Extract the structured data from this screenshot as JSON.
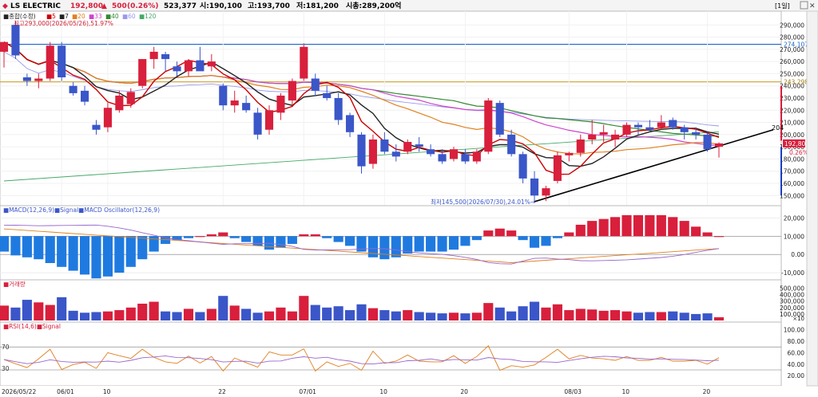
{
  "header": {
    "stock_name": "LS ELECTRIC",
    "price": "192,800",
    "change_arrow": "▲",
    "change": "500",
    "change_pct": "(0.26%)",
    "volume": "523,377",
    "open_label": "시:190,100",
    "high_label": "고:193,700",
    "low_label": "저:181,200",
    "mcap_label": "시총:289,200억",
    "period_button": "[1일]"
  },
  "main_panel": {
    "legend_title": "■종합(수정)",
    "ma_legend": [
      {
        "label": "5",
        "color": "#cc0000"
      },
      {
        "label": "7",
        "color": "#222222"
      },
      {
        "label": "20",
        "color": "#e08020"
      },
      {
        "label": "33",
        "color": "#cc44cc"
      },
      {
        "label": "40",
        "color": "#338833"
      },
      {
        "label": "60",
        "color": "#9999ee"
      },
      {
        "label": "120",
        "color": "#44aa66"
      }
    ],
    "high_note": "최고293,000(2026/05/26),51.97%",
    "low_note": "최저145,500(2026/07/30),24.01%→",
    "trend_label": "204",
    "price_ticks": [
      "290,000",
      "280,000",
      "270,000",
      "260,000",
      "250,000",
      "240,000",
      "230,000",
      "220,000",
      "210,000",
      "200,000",
      "190,000",
      "180,000",
      "170,000",
      "160,000",
      "150,000"
    ],
    "hline_blue_label": "274,107",
    "hline_gold_label": "243,298",
    "current_price_label": "192,800",
    "current_pct_label": "0.26%",
    "colors": {
      "up": "#d81f3c",
      "down": "#3a56c8",
      "hline_blue": "#1a66cc",
      "hline_gold": "#c9a030"
    }
  },
  "macd_panel": {
    "legend": "■MACD(12,26,9)■Signal■MACD Oscillator(12,26,9)",
    "ticks": [
      "20,000",
      "10,000",
      "0.00",
      "-10,000"
    ]
  },
  "volume_panel": {
    "legend": "■거래량",
    "ticks": [
      "500,000",
      "400,000",
      "300,000",
      "200,000",
      "100,000"
    ],
    "unit": "×10"
  },
  "rsi_panel": {
    "legend": "■RSI(14,6)■Signal",
    "ticks": [
      "100.00",
      "80.00",
      "60.00",
      "40.00",
      "20.00"
    ],
    "level_70": "70",
    "level_30": "30"
  },
  "x_axis": {
    "labels": [
      "2026/05/22",
      "06/01",
      "10",
      "22",
      "07/01",
      "10",
      "20",
      "08/03",
      "10",
      "20"
    ]
  },
  "chart_data": {
    "type": "candlestick",
    "ylim": [
      143000,
      300000
    ],
    "ma_periods": [
      5,
      7,
      20,
      33,
      40,
      60,
      120
    ],
    "dates": [
      "05/22",
      "05/26",
      "05/27",
      "05/28",
      "05/29",
      "06/01",
      "06/02",
      "06/04",
      "06/05",
      "06/08",
      "06/09",
      "06/10",
      "06/11",
      "06/12",
      "06/15",
      "06/16",
      "06/17",
      "06/18",
      "06/19",
      "06/22",
      "06/23",
      "06/24",
      "06/25",
      "06/26",
      "06/29",
      "06/30",
      "07/01",
      "07/02",
      "07/03",
      "07/06",
      "07/07",
      "07/08",
      "07/09",
      "07/10",
      "07/13",
      "07/14",
      "07/15",
      "07/16",
      "07/17",
      "07/20",
      "07/21",
      "07/22",
      "07/23",
      "07/24",
      "07/27",
      "07/28",
      "07/29",
      "07/30",
      "07/31",
      "08/03",
      "08/04",
      "08/05",
      "08/06",
      "08/07",
      "08/10",
      "08/11",
      "08/12",
      "08/13",
      "08/14",
      "08/17",
      "08/18",
      "08/19",
      "08/20"
    ],
    "candles": [
      {
        "o": 268000,
        "h": 275000,
        "l": 255000,
        "c": 276000
      },
      {
        "o": 290000,
        "h": 293000,
        "l": 262000,
        "c": 265000
      },
      {
        "o": 247000,
        "h": 250000,
        "l": 240000,
        "c": 244000
      },
      {
        "o": 244000,
        "h": 250000,
        "l": 238000,
        "c": 246000
      },
      {
        "o": 246000,
        "h": 276000,
        "l": 244000,
        "c": 273000
      },
      {
        "o": 273000,
        "h": 276000,
        "l": 244000,
        "c": 247000
      },
      {
        "o": 240000,
        "h": 243000,
        "l": 232000,
        "c": 234000
      },
      {
        "o": 236000,
        "h": 240000,
        "l": 224000,
        "c": 227000
      },
      {
        "o": 208000,
        "h": 212000,
        "l": 200000,
        "c": 204000
      },
      {
        "o": 206000,
        "h": 226000,
        "l": 202000,
        "c": 222000
      },
      {
        "o": 220000,
        "h": 236000,
        "l": 218000,
        "c": 232000
      },
      {
        "o": 225000,
        "h": 238000,
        "l": 222000,
        "c": 235000
      },
      {
        "o": 240000,
        "h": 262000,
        "l": 238000,
        "c": 262000
      },
      {
        "o": 262000,
        "h": 272000,
        "l": 254000,
        "c": 268000
      },
      {
        "o": 266000,
        "h": 268000,
        "l": 252000,
        "c": 262000
      },
      {
        "o": 256000,
        "h": 260000,
        "l": 248000,
        "c": 252000
      },
      {
        "o": 252000,
        "h": 262000,
        "l": 248000,
        "c": 261000
      },
      {
        "o": 261000,
        "h": 272000,
        "l": 256000,
        "c": 252000
      },
      {
        "o": 256000,
        "h": 266000,
        "l": 252000,
        "c": 260000
      },
      {
        "o": 240000,
        "h": 242000,
        "l": 220000,
        "c": 224000
      },
      {
        "o": 224000,
        "h": 236000,
        "l": 218000,
        "c": 228000
      },
      {
        "o": 226000,
        "h": 232000,
        "l": 218000,
        "c": 220000
      },
      {
        "o": 218000,
        "h": 222000,
        "l": 196000,
        "c": 200000
      },
      {
        "o": 204000,
        "h": 224000,
        "l": 200000,
        "c": 220000
      },
      {
        "o": 218000,
        "h": 234000,
        "l": 212000,
        "c": 232000
      },
      {
        "o": 228000,
        "h": 246000,
        "l": 224000,
        "c": 244000
      },
      {
        "o": 246000,
        "h": 275000,
        "l": 244000,
        "c": 272000
      },
      {
        "o": 246000,
        "h": 250000,
        "l": 232000,
        "c": 236000
      },
      {
        "o": 234000,
        "h": 240000,
        "l": 228000,
        "c": 230000
      },
      {
        "o": 230000,
        "h": 234000,
        "l": 208000,
        "c": 212000
      },
      {
        "o": 216000,
        "h": 218000,
        "l": 198000,
        "c": 202000
      },
      {
        "o": 200000,
        "h": 202000,
        "l": 168000,
        "c": 174000
      },
      {
        "o": 176000,
        "h": 200000,
        "l": 172000,
        "c": 196000
      },
      {
        "o": 196000,
        "h": 202000,
        "l": 184000,
        "c": 186000
      },
      {
        "o": 186000,
        "h": 192000,
        "l": 178000,
        "c": 182000
      },
      {
        "o": 186000,
        "h": 196000,
        "l": 184000,
        "c": 194000
      },
      {
        "o": 192000,
        "h": 198000,
        "l": 186000,
        "c": 190000
      },
      {
        "o": 188000,
        "h": 192000,
        "l": 182000,
        "c": 184000
      },
      {
        "o": 184000,
        "h": 188000,
        "l": 176000,
        "c": 178000
      },
      {
        "o": 180000,
        "h": 190000,
        "l": 178000,
        "c": 188000
      },
      {
        "o": 184000,
        "h": 188000,
        "l": 176000,
        "c": 178000
      },
      {
        "o": 178000,
        "h": 188000,
        "l": 176000,
        "c": 186000
      },
      {
        "o": 186000,
        "h": 230000,
        "l": 184000,
        "c": 228000
      },
      {
        "o": 226000,
        "h": 228000,
        "l": 198000,
        "c": 200000
      },
      {
        "o": 200000,
        "h": 204000,
        "l": 182000,
        "c": 184000
      },
      {
        "o": 184000,
        "h": 186000,
        "l": 160000,
        "c": 164000
      },
      {
        "o": 164000,
        "h": 170000,
        "l": 145500,
        "c": 150000
      },
      {
        "o": 150000,
        "h": 158000,
        "l": 145500,
        "c": 156000
      },
      {
        "o": 162000,
        "h": 186000,
        "l": 160000,
        "c": 183000
      },
      {
        "o": 183000,
        "h": 186000,
        "l": 178000,
        "c": 185000
      },
      {
        "o": 185000,
        "h": 200000,
        "l": 182000,
        "c": 196000
      },
      {
        "o": 196000,
        "h": 212000,
        "l": 192000,
        "c": 200000
      },
      {
        "o": 200000,
        "h": 208000,
        "l": 194000,
        "c": 202000
      },
      {
        "o": 196000,
        "h": 204000,
        "l": 190000,
        "c": 200000
      },
      {
        "o": 200000,
        "h": 210000,
        "l": 198000,
        "c": 208000
      },
      {
        "o": 208000,
        "h": 210000,
        "l": 200000,
        "c": 206000
      },
      {
        "o": 206000,
        "h": 212000,
        "l": 202000,
        "c": 204000
      },
      {
        "o": 206000,
        "h": 216000,
        "l": 204000,
        "c": 210000
      },
      {
        "o": 212000,
        "h": 214000,
        "l": 204000,
        "c": 206000
      },
      {
        "o": 206000,
        "h": 208000,
        "l": 196000,
        "c": 202000
      },
      {
        "o": 202000,
        "h": 206000,
        "l": 196000,
        "c": 200000
      },
      {
        "o": 200000,
        "h": 202000,
        "l": 186000,
        "c": 188000
      },
      {
        "o": 190100,
        "h": 193700,
        "l": 181200,
        "c": 192800
      }
    ]
  }
}
